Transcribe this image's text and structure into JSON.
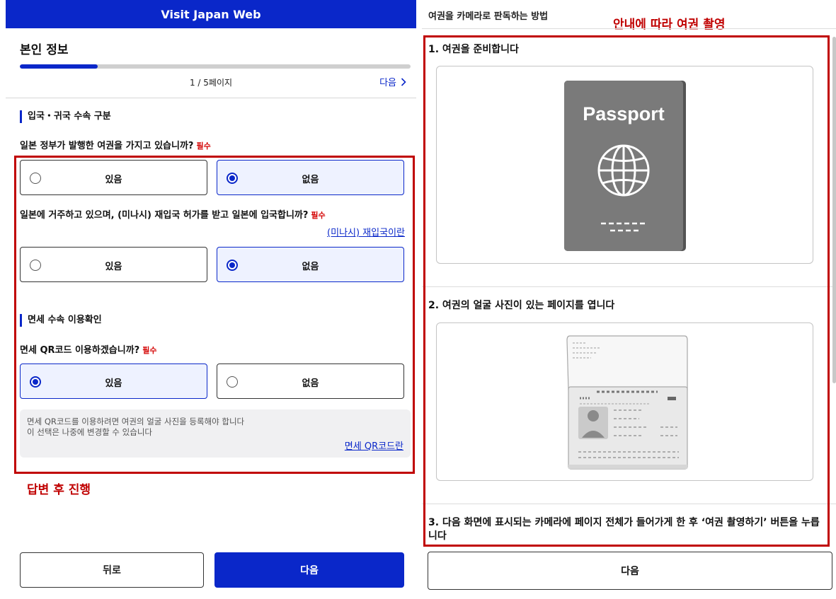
{
  "left": {
    "header_title": "Visit Japan Web",
    "page_title": "본인 정보",
    "progress_fraction": 0.2,
    "page_indicator": "1 / 5페이지",
    "next_link_label": "다음",
    "section1_title": "입국・귀국 수속 구분",
    "q1": {
      "text": "일본 정부가 발행한 여권을 가지고 있습니까?",
      "required": "필수",
      "options": [
        "있음",
        "없음"
      ],
      "selected": "없음"
    },
    "q2": {
      "text": "일본에 거주하고 있으며, (미나시) 재입국 허가를 받고 일본에 입국합니까?",
      "required": "필수",
      "help_link": "(미나시) 재입국이란",
      "options": [
        "있음",
        "없음"
      ],
      "selected": "없음"
    },
    "section2_title": "면세 수속 이용확인",
    "q3": {
      "text": "면세 QR코드 이용하겠습니까?",
      "required": "필수",
      "options": [
        "있음",
        "없음"
      ],
      "selected": "있음"
    },
    "note": {
      "line1": "면세 QR코드를 이용하려면 여권의 얼굴 사진을 등록해야 합니다",
      "line2": "이 선택은 나중에 변경할 수 있습니다",
      "link": "면세 QR코드란"
    },
    "back_button": "뒤로",
    "next_button": "다음",
    "annotation": "답변 후 진행"
  },
  "right": {
    "title": "여권을 카메라로 판독하는 방법",
    "annotation": "안내에 따라 여권 촬영",
    "step1": "1. 여권을 준비합니다",
    "passport_cover_text": "Passport",
    "step2": "2. 여권의 얼굴 사진이 있는 페이지를 엽니다",
    "step3": "3. 다음 화면에 표시되는 카메라에 페이지 전체가 들어가게 한 후 ‘여권 촬영하기’ 버튼을 누릅니다",
    "next_button": "다음"
  },
  "colors": {
    "brand_blue": "#0a27c9",
    "annotation_red": "#c00000",
    "required_red": "#d40000"
  }
}
